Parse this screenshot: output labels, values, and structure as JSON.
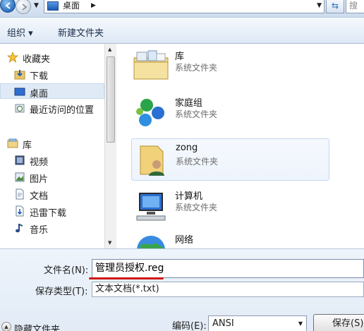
{
  "address": {
    "path_item": "桌面",
    "search_placeholder": "搜"
  },
  "toolbar": {
    "organize_label": "组织 ▾",
    "new_folder_label": "新建文件夹"
  },
  "nav": {
    "favorites": "收藏夹",
    "downloads": "下载",
    "desktop": "桌面",
    "recent": "最近访问的位置",
    "libraries": "库",
    "videos": "视频",
    "pictures": "图片",
    "documents": "文档",
    "thunder": "迅雷下载",
    "music": "音乐"
  },
  "content": {
    "items": [
      {
        "name": "库",
        "type": "系统文件夹"
      },
      {
        "name": "家庭组",
        "type": "系统文件夹"
      },
      {
        "name": "zong",
        "type": "系统文件夹"
      },
      {
        "name": "计算机",
        "type": "系统文件夹"
      },
      {
        "name": "网络",
        "type": ""
      }
    ]
  },
  "form": {
    "filename_label": "文件名(N):",
    "filename_value": "管理员授权.reg",
    "savetype_label": "保存类型(T):",
    "savetype_value": "文本文档(*.txt)",
    "hide_folders_label": "隐藏文件夹",
    "encoding_label": "编码(E):",
    "encoding_value": "ANSI",
    "save_label": "保存(S)"
  }
}
